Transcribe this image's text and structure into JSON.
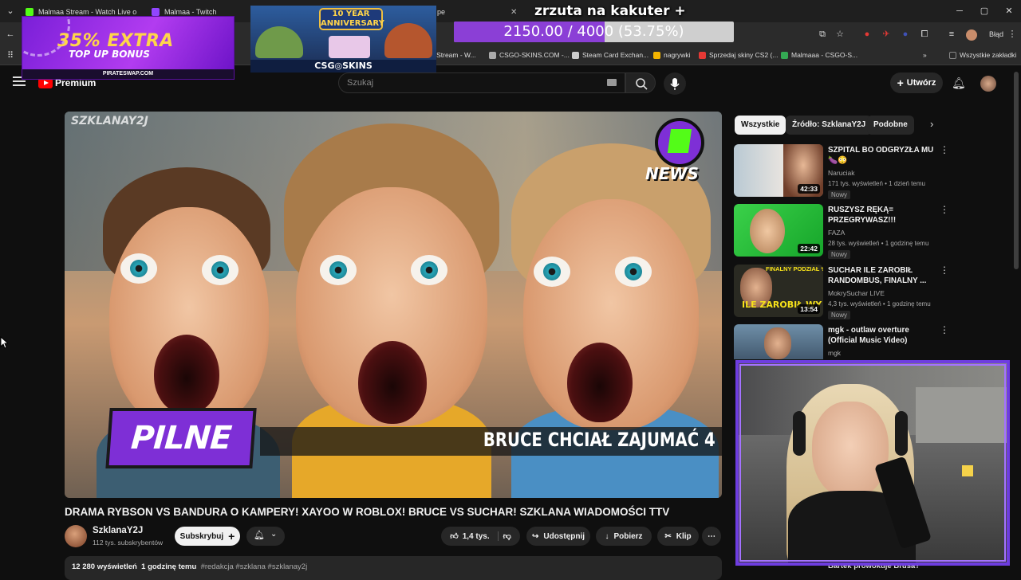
{
  "browser": {
    "tabs": [
      {
        "title": "Malmaa Stream - Watch Live o",
        "color": "#53fc18"
      },
      {
        "title": "Malmaa - Twitch",
        "color": "#9146ff"
      },
      {
        "title": "pe",
        "color": "#888888"
      }
    ],
    "bookmarks": [
      {
        "label": "a Stream - W...",
        "color": "#53fc18"
      },
      {
        "label": "CSGO-SKINS.COM -...",
        "color": "#aaaaaa"
      },
      {
        "label": "Steam Card Exchan...",
        "color": "#cccccc"
      },
      {
        "label": "nagrywki",
        "color": "#f4b400"
      },
      {
        "label": "Sprzedaj skiny CS2 (...",
        "color": "#e53935"
      },
      {
        "label": "Malmaaa - CSGO-S...",
        "color": "#34a853"
      },
      {
        "label": "Wszystkie zakładki",
        "color": "#888888"
      }
    ],
    "profile_label": "Błąd"
  },
  "overlay": {
    "promo1": {
      "line1": "35% EXTRA",
      "line2": "TOP UP BONUS",
      "site": "PIRATESWAP.COM"
    },
    "promo2": {
      "badge": "10 YEAR ANNIVERSARY",
      "brand": "CSG◎SKINS"
    },
    "stream_title": "zrzuta na kakuter +",
    "goal": {
      "text": "2150.00 / 4000 (53.75%)",
      "current": 2150.0,
      "target": 4000,
      "percent": 53.75
    }
  },
  "youtube": {
    "logo_label": "Premium",
    "search_placeholder": "Szukaj",
    "create_label": "Utwórz",
    "video": {
      "watermark": "SZKLANAY2J",
      "badge": "NEWS",
      "stamp": "PILNE",
      "ticker": "BRUCE CHCIAŁ ZAJUMAĆ 4"
    },
    "title": "DRAMA RYBSON VS BANDURA O KAMPERY! XAYOO W ROBLOX! BRUCE VS SUCHAR! SZKLANA WIADOMOŚCI TTV",
    "channel": {
      "name": "SzklanaY2J",
      "subscribers": "112 tys. subskrybentów"
    },
    "subscribe_label": "Subskrybuj",
    "likes": "1,4 tys.",
    "share_label": "Udostępnij",
    "download_label": "Pobierz",
    "clip_label": "Klip",
    "description": {
      "views": "12 280 wyświetleń",
      "time": "1 godzinę temu",
      "tags": "#redakcja #szklana #szklanay2j"
    },
    "chips": [
      "Wszystkie",
      "Źródło: SzklanaY2J",
      "Podobne"
    ],
    "recommendations": [
      {
        "title": "SZPITAL BO ODGRYZŁA MU 🍆😳",
        "channel": "Naruciak",
        "meta": "171 tys. wyświetleń • 1 dzień temu",
        "badge": "Nowy",
        "duration": "42:33"
      },
      {
        "title": "RUSZYSZ RĘKĄ= PRZEGRYWASZ!!!",
        "channel": "FAZA",
        "meta": "28 tys. wyświetleń • 1 godzinę temu",
        "badge": "Nowy",
        "duration": "22:42"
      },
      {
        "title": "SUCHAR ILE ZAROBIŁ RANDOMBUS, FINALNY ...",
        "channel": "MokrySuchar LIVE",
        "meta": "4,3 tys. wyświetleń • 1 godzinę temu",
        "badge": "Nowy",
        "duration": "13:54"
      },
      {
        "title": "mgk - outlaw overture (Official Music Video)",
        "channel": "mgk",
        "meta": "",
        "badge": "",
        "duration": ""
      }
    ],
    "thumb_text_3": "ILE ZAROBIŁ WY",
    "thumb_top_3": "FINALNY PODZIAŁ %",
    "partial_next": "Bartek prowokuje Brusa?"
  }
}
